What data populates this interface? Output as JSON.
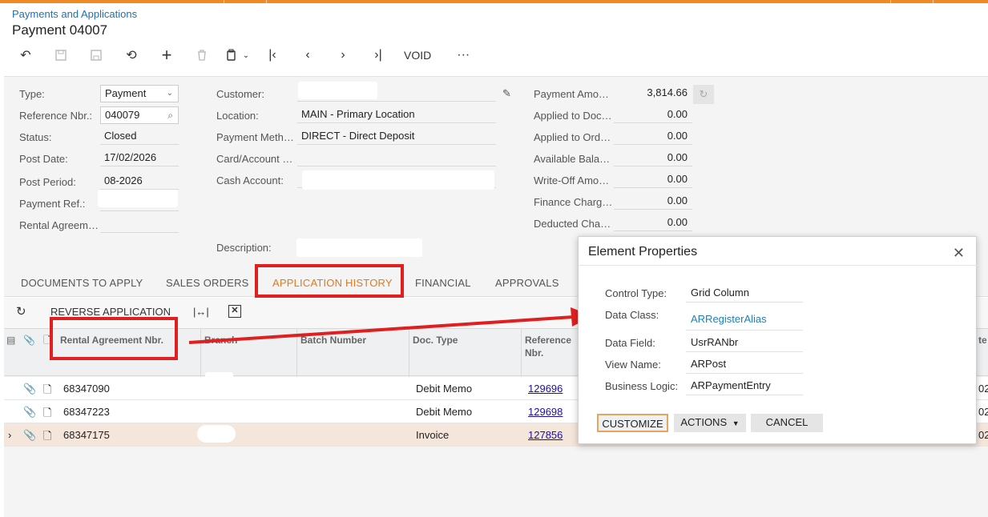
{
  "breadcrumb": "Payments and Applications",
  "page_title": "Payment 04007",
  "toolbar": {
    "void_label": "VOID",
    "more_label": "···"
  },
  "summary": {
    "type_label": "Type:",
    "type_value": "Payment",
    "refnbr_label": "Reference Nbr.:",
    "refnbr_value": "040079",
    "status_label": "Status:",
    "status_value": "Closed",
    "postdate_label": "Post Date:",
    "postdate_value": "17/02/2026",
    "postperiod_label": "Post Period:",
    "postperiod_value": "08-2026",
    "payref_label": "Payment Ref.:",
    "rental_label": "Rental Agreem…",
    "customer_label": "Customer:",
    "location_label": "Location:",
    "location_value": "MAIN - Primary Location",
    "paymeth_label": "Payment Meth…",
    "paymeth_value": "DIRECT - Direct Deposit",
    "card_label": "Card/Account …",
    "cash_label": "Cash Account:",
    "desc_label": "Description:",
    "amounts": [
      {
        "label": "Payment Amo…",
        "value": "3,814.66"
      },
      {
        "label": "Applied to Doc…",
        "value": "0.00"
      },
      {
        "label": "Applied to Ord…",
        "value": "0.00"
      },
      {
        "label": "Available Bala…",
        "value": "0.00"
      },
      {
        "label": "Write-Off Amo…",
        "value": "0.00"
      },
      {
        "label": "Finance Charg…",
        "value": "0.00"
      },
      {
        "label": "Deducted Cha…",
        "value": "0.00"
      }
    ]
  },
  "tabs": [
    "DOCUMENTS TO APPLY",
    "SALES ORDERS",
    "APPLICATION HISTORY",
    "FINANCIAL",
    "APPROVALS"
  ],
  "grid_toolbar": {
    "reverse_label": "REVERSE APPLICATION"
  },
  "grid": {
    "columns": [
      "Rental Agreement Nbr.",
      "Branch",
      "Batch Number",
      "Doc. Type",
      "Reference\nNbr.",
      "te"
    ],
    "rows": [
      {
        "rental": "68347090",
        "doctype": "Debit Memo",
        "ref": "129696",
        "tail": "02"
      },
      {
        "rental": "68347223",
        "doctype": "Debit Memo",
        "ref": "129698",
        "tail": "02"
      },
      {
        "rental": "68347175",
        "doctype": "Invoice",
        "ref": "127856",
        "tail": "02"
      }
    ]
  },
  "dialog": {
    "title": "Element Properties",
    "fields": [
      {
        "label": "Control Type:",
        "value": "Grid Column"
      },
      {
        "label": "Data Class:",
        "value": "ARRegisterAlias"
      },
      {
        "label": "Data Field:",
        "value": "UsrRANbr"
      },
      {
        "label": "View Name:",
        "value": "ARPost"
      },
      {
        "label": "Business Logic:",
        "value": "ARPaymentEntry"
      }
    ],
    "customize_label": "CUSTOMIZE",
    "actions_label": "ACTIONS",
    "cancel_label": "CANCEL"
  },
  "colors": {
    "accent": "#e07b1a",
    "link": "#1f7fb6",
    "highlight": "#e02020"
  }
}
